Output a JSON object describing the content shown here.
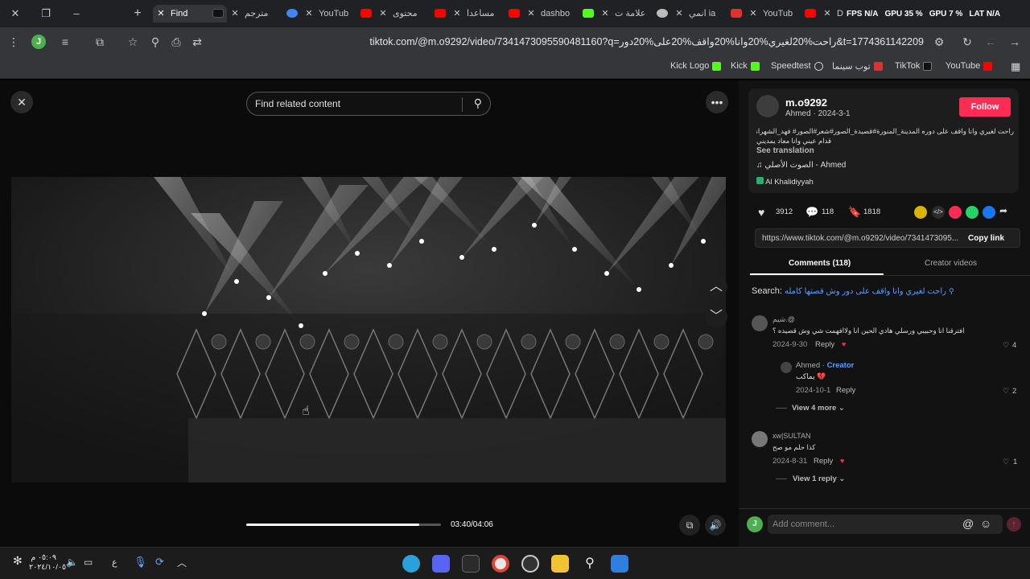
{
  "tabs": [
    {
      "label": "Find",
      "active": true,
      "color": "#ffffff"
    },
    {
      "label": "مترجم",
      "color": "#4285f4"
    },
    {
      "label": "YouTub",
      "color": "#ff0000"
    },
    {
      "label": "محتوى",
      "color": "#ff0000"
    },
    {
      "label": "مساعدا",
      "color": "#ff0000"
    },
    {
      "label": "dashbo",
      "color": "#53fc18"
    },
    {
      "label": "علامة ت",
      "color": "#c0c0c0"
    },
    {
      "label": "انمي ia",
      "color": "#e03030"
    },
    {
      "label": "YouTub",
      "color": "#ff0000"
    },
    {
      "label": "D",
      "color": "#5865f2"
    }
  ],
  "perf": {
    "fps": "FPS N/A",
    "gpu": "GPU 35 %",
    "gpu2": "GPU 7 %",
    "lat": "LAT N/A"
  },
  "toolbar": {
    "url": "tiktok.com/@m.o9292/video/7341473095590481160?q=راحت%20لغيري%20وانا%20واقف%20على%20دور&t=1774361142209",
    "avatar_letter": "J"
  },
  "bookmarks": [
    {
      "label": "Kick Logo",
      "color": "#53fc18"
    },
    {
      "label": "Kick",
      "color": "#53fc18"
    },
    {
      "label": "Speedtest",
      "color": "#cccccc"
    },
    {
      "label": "توب سينما",
      "color": "#e03030"
    },
    {
      "label": "TikTok",
      "color": "#ffffff"
    },
    {
      "label": "YouTube",
      "color": "#ff0000"
    }
  ],
  "video": {
    "search_placeholder": "Find related content",
    "time": "03:40/04:06",
    "progress": 0.89
  },
  "post": {
    "username": "m.o9292",
    "meta": "Ahmed · 2024-3-1",
    "follow": "Follow",
    "caption_line1": "راحت لغيري وانا واقف على دوره المدينة_المنورة#قصيدة_الصور#شعر#الصور# فهد_الشهراني#",
    "caption_line2": "قدام عيني وانا معاد يمديني",
    "see_translation": "See translation",
    "sound": "الصوت الأصلي - Ahmed",
    "location": "Al Khalidiyyah",
    "likes": "3912",
    "comments": "118",
    "saves": "1818",
    "link": "https://www.tiktok.com/@m.o9292/video/7341473095...",
    "copy_link": "Copy link",
    "tab_comments": "Comments (118)",
    "tab_creator": "Creator videos",
    "search_prefix": "Search:",
    "search_query": "راحت لغيري وانا واقف على دور وش قصتها كامله"
  },
  "comments": [
    {
      "user": "شيم.@",
      "text": "افترقنا انا وحبيبي ورسلي هادي الحين انا ولاافهمت شي وش قصيده ؟",
      "date": "2024-9-30",
      "reply": "Reply",
      "likes": "4"
    },
    {
      "user": "Ahmed",
      "creator": "Creator",
      "text": "يماكب 💔",
      "date": "2024-10-1",
      "reply": "Reply",
      "likes": "2"
    },
    {
      "view_more": "View 4 more"
    },
    {
      "user": "xw|SULTAN",
      "text": "كذا حلم مو صح",
      "date": "2024-8-31",
      "reply": "Reply",
      "likes": "1"
    },
    {
      "view_more": "View 1 reply"
    }
  ],
  "add_comment": {
    "placeholder": "Add comment...",
    "avatar_letter": "J"
  },
  "taskbar": {
    "time": "٠٥:٠٩ م",
    "date": "٢٠٢٤/١٠/٠٥",
    "lang": "ع"
  }
}
